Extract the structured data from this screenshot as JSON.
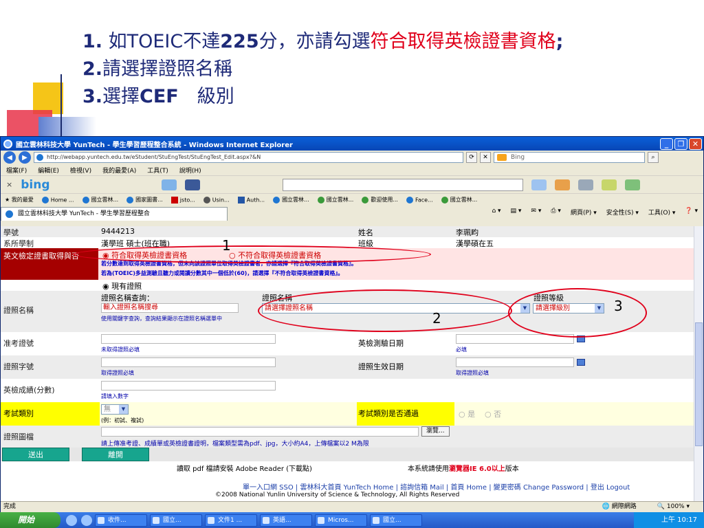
{
  "slide": {
    "line1_num": "1.",
    "line1_a": " 如TOEIC不達",
    "line1_score": "225",
    "line1_b": "分，亦請勾選",
    "line1_red": "符合取得英檢證書資格",
    "line1_end": ";",
    "line2_num": "2.",
    "line2_text": "請選擇證照名稱",
    "line3_num": "3.",
    "line3_a": "選擇",
    "line3_cef": "CEF",
    "line3_b": "　級別"
  },
  "window": {
    "title": "國立雲林科技大學 YunTech - 學生學習歷程整合系統 - Windows Internet Explorer",
    "min_label": "_",
    "max_label": "❐",
    "close_label": "✕",
    "address": "http://webapp.yuntech.edu.tw/eStudent/StuEngTest/StuEngTest_Edit.aspx?&N",
    "search_text": "Bing",
    "menu": [
      "檔案(F)",
      "編輯(E)",
      "檢視(V)",
      "我的最愛(A)",
      "工具(T)",
      "說明(H)"
    ],
    "bing_logo": "bing",
    "favorites": [
      "我的最愛",
      "Home ...",
      "國立雲林...",
      "國家圖書...",
      "jsto...",
      "Usin...",
      "Auth...",
      "國立雲林...",
      "國立雲林...",
      "歡迎使用...",
      "Face...",
      "國立雲林..."
    ],
    "tab_title": "國立雲林科技大學 YunTech - 學生學習歷程整合",
    "commands": [
      "網頁(P) ▾",
      "安全性(S) ▾",
      "工具(O) ▾"
    ]
  },
  "form": {
    "student_id_label": "學號",
    "student_id": "9444213",
    "name_label": "姓名",
    "name_value": "李珮畇",
    "dept_label": "系所學制",
    "dept_value": "漢學班 碩士(班在職)",
    "class_label": "班級",
    "class_value": "漢學碩在五",
    "cert_label": "英文檢定證書取得與否",
    "opt_yes": "符合取得英檢證書資格",
    "opt_no": "不符合取得英檢證書資格",
    "note1": "若分數達到取得英檢證書資格，但未向該證照單位取得英檢證書者，亦請選擇『符合取得英檢證書資格』。",
    "note2": "若為(TOEIC)多益測驗且聽力或閱讀分數其中一個低於(60)，請選擇『不符合取得英檢證書資格』。",
    "current_cert": "現有證照",
    "cert_name_label": "證照名稱",
    "cert_query_label": "證照名稱查詢：",
    "cert_query_value": "輸入證照名稱搜尋",
    "cert_query_hint": "使用關鍵字查詢，查詢結果顯示在證照名稱選單中",
    "cert_name_col": "證照名稱",
    "cert_name_select": "請選擇證照名稱",
    "cert_level_col": "證照等級",
    "cert_level_select": "請選擇級別",
    "admit_label": "准考證號",
    "admit_hint": "未取得證照必填",
    "test_date_label": "英檢測驗日期",
    "test_date_hint": "必填",
    "cert_no_label": "證照字號",
    "cert_no_hint": "取得證照必填",
    "effective_label": "證照生效日期",
    "effective_hint": "取得證照必填",
    "score_label": "英檢成績(分數)",
    "score_hint": "請填入數字",
    "exam_type_label": "考試類別",
    "exam_type_value": "無",
    "exam_type_hint": "(例：初試、複試)",
    "exam_pass_label": "考試類別是否通過",
    "exam_pass_yes": "是",
    "exam_pass_no": "否",
    "attach_label": "證照圖檔",
    "browse_label": "瀏覽...",
    "attach_hint": "請上傳准考證、成績單或英檢證書證明，檔案類型需為pdf、jpg，大小約A4，上傳檔案以2 M為限",
    "save_label": "送出",
    "leave_label": "離開",
    "footer1": "讀取 pdf 檔請安裝 Adobe Reader (下載點)",
    "footer2a": "本系統請使用",
    "footer2b": "瀏覽器IE 6.0以上",
    "footer2c": "版本",
    "footer_links": "單一入口網 SSO | 雲林科大首頁 YunTech Home | 諮詢信箱 Mail | 首頁 Home | 變更密碼 Change Password | 登出 Logout",
    "copyright": "©2008 National Yunlin University of Science & Technology, All Rights Reserved"
  },
  "annotations": {
    "a1": "1",
    "a2": "2",
    "a3": "3"
  },
  "status": {
    "left": "完成",
    "zone": "網際網路",
    "zoom": "100%"
  },
  "taskbar": {
    "start": "開始",
    "tasks": [
      "收件...",
      "國立...",
      "文件1 ...",
      "英語...",
      "Micros...",
      "國立..."
    ],
    "clock": "上午 10:17"
  },
  "colors": {
    "accent_red": "#e0001b",
    "title_blue": "#1e2a78",
    "form_pink": "#ffe4e4",
    "form_dark_red": "#a50000",
    "yellow": "#ffff00"
  }
}
